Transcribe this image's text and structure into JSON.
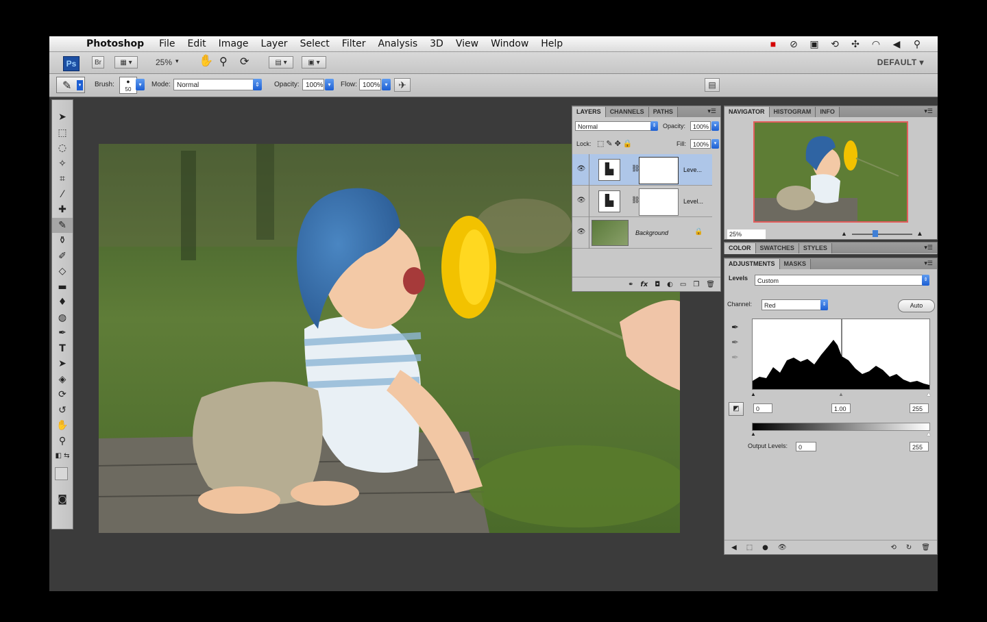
{
  "menubar": {
    "app": "Photoshop",
    "items": [
      "File",
      "Edit",
      "Image",
      "Layer",
      "Select",
      "Filter",
      "Analysis",
      "3D",
      "View",
      "Window",
      "Help"
    ]
  },
  "appbar": {
    "logo": "Ps",
    "bridge": "Br",
    "zoom": "25%",
    "workspace": "DEFAULT ▾"
  },
  "options": {
    "brush_label": "Brush:",
    "brush_size": "50",
    "mode_label": "Mode:",
    "mode_value": "Normal",
    "opacity_label": "Opacity:",
    "opacity_value": "100%",
    "flow_label": "Flow:",
    "flow_value": "100%"
  },
  "layers_panel": {
    "tabs": [
      "LAYERS",
      "CHANNELS",
      "PATHS"
    ],
    "blend": "Normal",
    "opacity_label": "Opacity:",
    "opacity_value": "100%",
    "lock_label": "Lock:",
    "fill_label": "Fill:",
    "fill_value": "100%",
    "layers": [
      {
        "name": "Leve..."
      },
      {
        "name": "Level..."
      },
      {
        "name": "Background"
      }
    ]
  },
  "navigator": {
    "tabs": [
      "NAVIGATOR",
      "HISTOGRAM",
      "INFO"
    ],
    "zoom": "25%"
  },
  "color_panel": {
    "tabs": [
      "COLOR",
      "SWATCHES",
      "STYLES"
    ]
  },
  "adjustments": {
    "tabs": [
      "ADJUSTMENTS",
      "MASKS"
    ],
    "title": "Levels",
    "preset": "Custom",
    "channel_label": "Channel:",
    "channel": "Red",
    "auto": "Auto",
    "input_black": "0",
    "input_gamma": "1.00",
    "input_white": "255",
    "output_label": "Output Levels:",
    "output_black": "0",
    "output_white": "255"
  },
  "colors": {
    "accent": "#1d5fd3",
    "selected_layer": "#aec6e8",
    "navigator_frame": "#e35d5d"
  }
}
